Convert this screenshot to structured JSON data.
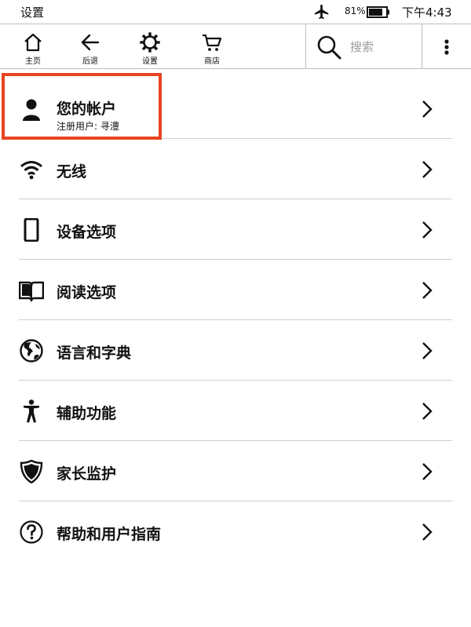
{
  "status_bar": {
    "title": "设置",
    "battery_percent": "81%",
    "time": "下午4:43",
    "battery_level": 0.81,
    "icons": [
      "airplane-icon",
      "battery-icon"
    ]
  },
  "toolbar": {
    "home_label": "主页",
    "back_label": "后退",
    "settings_label": "设置",
    "store_label": "商店",
    "search_placeholder": "搜索",
    "icons": [
      "home-icon",
      "back-arrow-icon",
      "gear-icon",
      "cart-icon",
      "search-icon",
      "more-vertical-icon"
    ]
  },
  "settings_list": {
    "items": [
      {
        "label": "您的帐户",
        "sub": "注册用户: 寻澧",
        "icon": "user-icon",
        "highlighted": true
      },
      {
        "label": "无线",
        "icon": "wifi-icon"
      },
      {
        "label": "设备选项",
        "icon": "device-icon"
      },
      {
        "label": "阅读选项",
        "icon": "book-icon"
      },
      {
        "label": "语言和字典",
        "icon": "globe-icon"
      },
      {
        "label": "辅助功能",
        "icon": "accessibility-icon"
      },
      {
        "label": "家长监护",
        "icon": "shield-icon"
      },
      {
        "label": "帮助和用户指南",
        "icon": "help-icon"
      }
    ]
  },
  "colors": {
    "highlight": "#e8431f",
    "divider": "#cfcfcf",
    "text": "#111111"
  }
}
